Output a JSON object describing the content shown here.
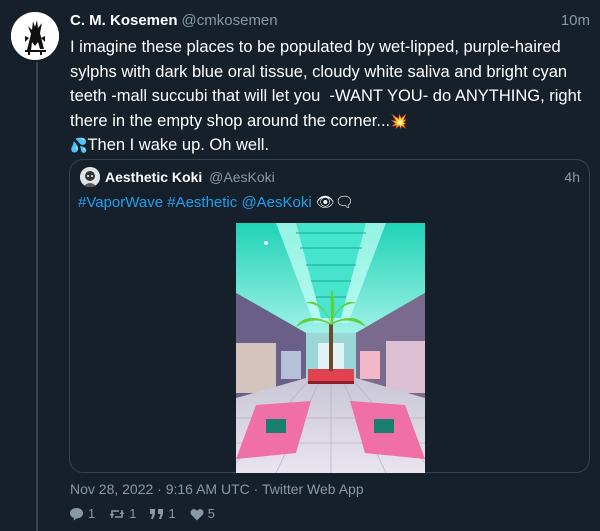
{
  "tweet": {
    "author_name": "C. M. Kosemen",
    "author_handle": "@cmkosemen",
    "time": "10m",
    "text": "I imagine these places to be populated by wet-lipped, purple-haired sylphs with dark blue oral tissue, cloudy white saliva and bright cyan teeth -mall succubi that will let you  -WANT YOU- do ANYTHING, right there in the empty shop around the corner...",
    "emoji_collision": "💥",
    "emoji_droplets": "💦",
    "text_end": "Then I wake up. Oh well.",
    "timestamp": "Nov 28, 2022 · 9:16 AM UTC · Twitter Web App"
  },
  "quote": {
    "author_name": "Aesthetic Koki",
    "author_handle": "@AesKoki",
    "time": "4h",
    "hashtag_1": "#VaporWave",
    "hashtag_2": "#Aesthetic",
    "mention": "@AesKoki",
    "emoji_eye": "👁",
    "emoji_speech": "🗨"
  },
  "actions": {
    "replies": "1",
    "retweets": "1",
    "quotes": "1",
    "likes": "5"
  },
  "icons": {
    "reply": "comment-icon",
    "retweet": "retweet-icon",
    "quote": "quote-icon",
    "like": "heart-icon"
  },
  "colors": {
    "background": "#15202b",
    "border": "#38444d",
    "muted": "#8899a6",
    "link": "#1da1f2"
  }
}
